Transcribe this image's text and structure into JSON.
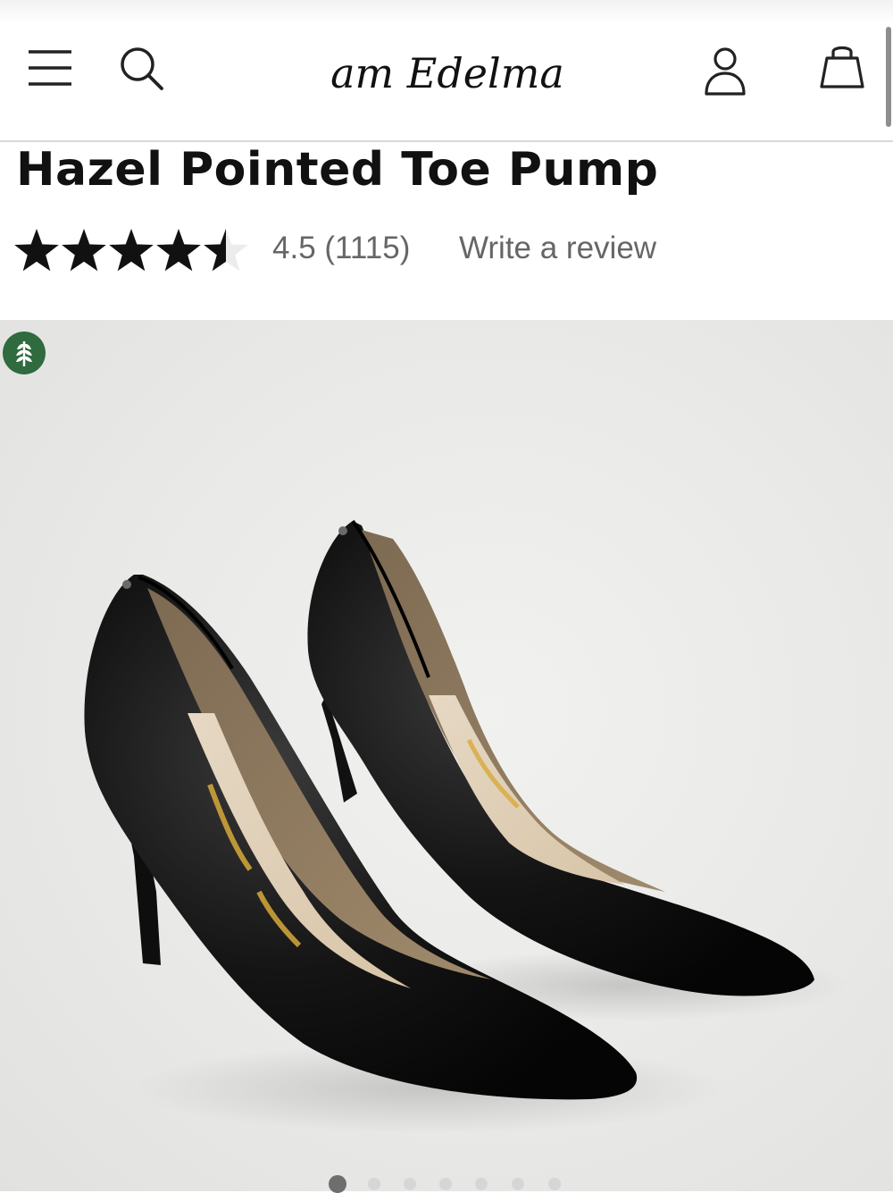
{
  "header": {
    "brand": "Sam Edelman",
    "icons": [
      "menu-icon",
      "search-icon",
      "account-icon",
      "shopping-bag-icon"
    ]
  },
  "product": {
    "title": "Hazel Pointed Toe Pump",
    "rating_value": 4.5,
    "rating_max": 5,
    "rating_text": "4.5 (1115)",
    "write_review_label": "Write a review"
  },
  "gallery": {
    "badge_icon": "wheat-leaf-icon",
    "image_alt": "Black leather pointed toe pumps with stiletto heels",
    "total_images": 7,
    "current_image": 1
  },
  "colors": {
    "badge_green": "#2f6b3f",
    "text": "#111111",
    "muted_text": "#666666"
  }
}
